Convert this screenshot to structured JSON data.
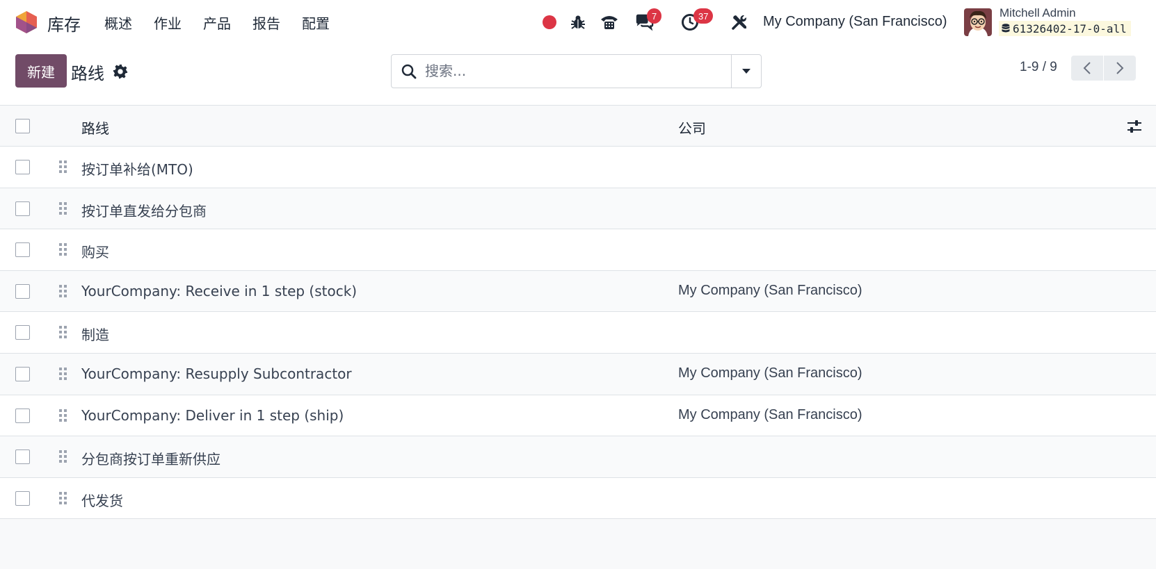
{
  "navbar": {
    "app_name": "库存",
    "menu": [
      "概述",
      "作业",
      "产品",
      "报告",
      "配置"
    ],
    "messages_count": "7",
    "activities_count": "37",
    "company": "My Company (San Francisco)",
    "user_name": "Mitchell Admin",
    "database": "61326402-17-0-all"
  },
  "control_panel": {
    "new_label": "新建",
    "title": "路线",
    "search_placeholder": "搜索...",
    "pager": "1-9 / 9"
  },
  "list": {
    "columns": {
      "route": "路线",
      "company": "公司"
    },
    "rows": [
      {
        "route": "按订单补给(MTO)",
        "company": ""
      },
      {
        "route": "按订单直发给分包商",
        "company": ""
      },
      {
        "route": "购买",
        "company": ""
      },
      {
        "route": "YourCompany: Receive in 1 step (stock)",
        "company": "My Company (San Francisco)"
      },
      {
        "route": "制造",
        "company": ""
      },
      {
        "route": "YourCompany: Resupply Subcontractor",
        "company": "My Company (San Francisco)"
      },
      {
        "route": "YourCompany: Deliver in 1 step (ship)",
        "company": "My Company (San Francisco)"
      },
      {
        "route": "分包商按订单重新供应",
        "company": ""
      },
      {
        "route": "代发货",
        "company": ""
      }
    ]
  },
  "colors": {
    "brand": "#714b67",
    "badge": "#dc3545",
    "recording": "#dc3545",
    "db_tag_bg": "#fcf8de"
  },
  "icons": [
    "odoo-logo-icon",
    "recording-icon",
    "bug-icon",
    "phone-icon",
    "chat-icon",
    "clock-icon",
    "tools-icon",
    "gear-icon",
    "search-icon",
    "caret-down-icon",
    "chevron-left-icon",
    "chevron-right-icon",
    "drag-handle-icon",
    "sliders-icon",
    "database-icon"
  ]
}
